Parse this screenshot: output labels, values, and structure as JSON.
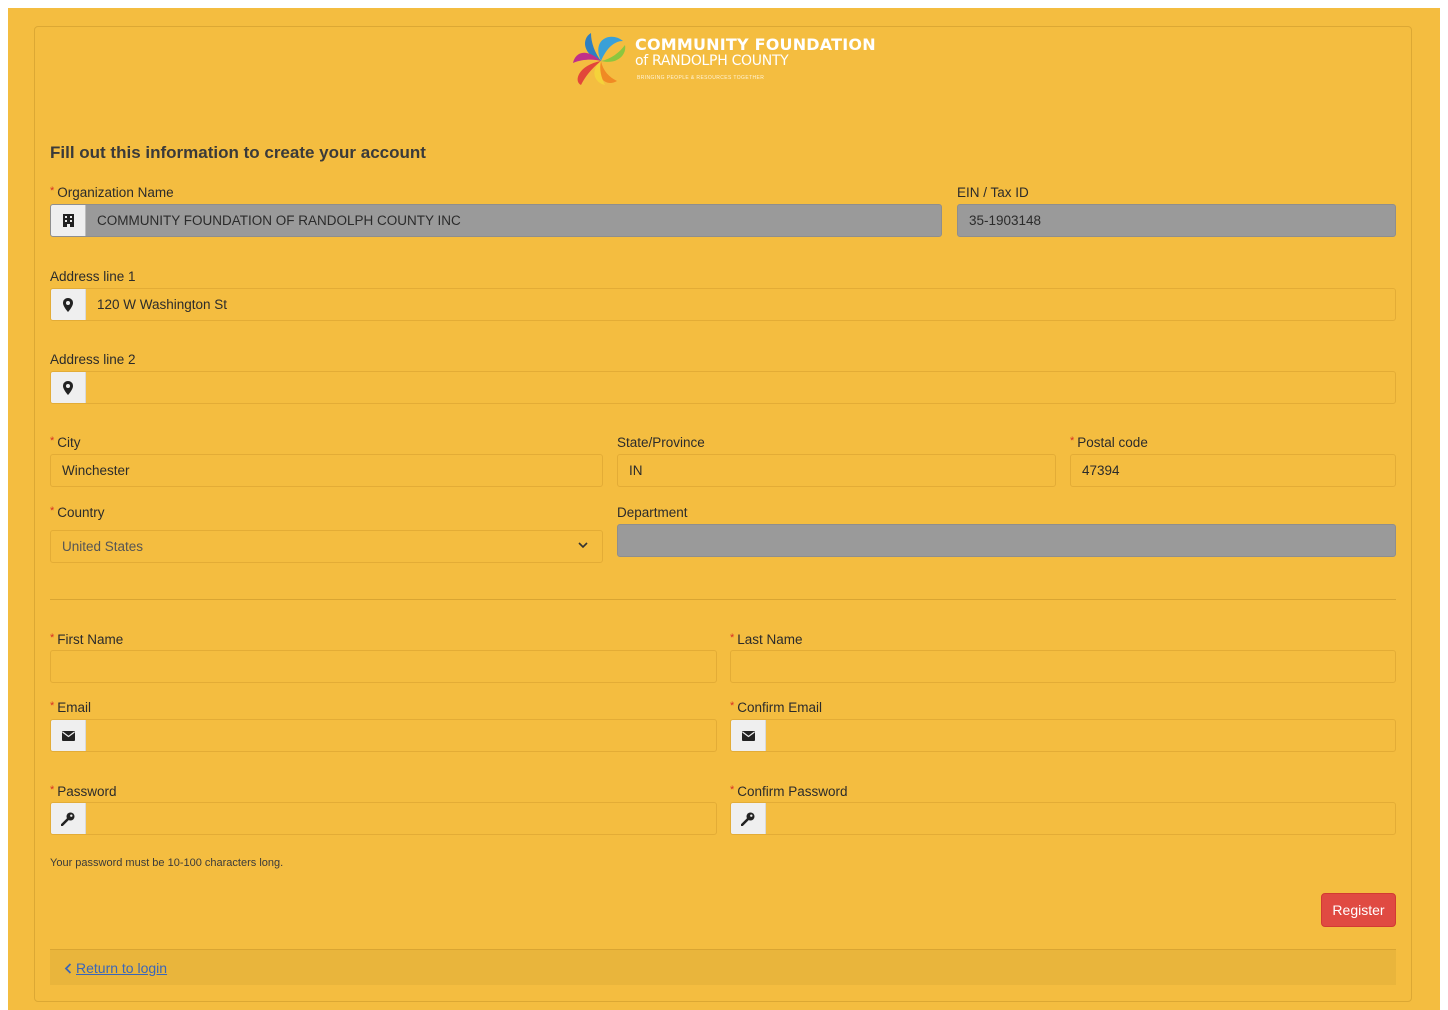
{
  "brand": {
    "line1": "COMMUNITY FOUNDATION",
    "line2": "of RANDOLPH COUNTY",
    "tagline": "Bringing people & resources together"
  },
  "form": {
    "heading": "Fill out this information to create your account",
    "org_name": {
      "label": "Organization Name",
      "value": "COMMUNITY FOUNDATION OF RANDOLPH COUNTY INC",
      "icon": "building-icon"
    },
    "ein": {
      "label": "EIN / Tax ID",
      "value": "35-1903148"
    },
    "address1": {
      "label": "Address line 1",
      "value": "120 W Washington St",
      "icon": "map-pin-icon"
    },
    "address2": {
      "label": "Address line 2",
      "value": "",
      "icon": "map-pin-icon"
    },
    "city": {
      "label": "City",
      "value": "Winchester"
    },
    "state": {
      "label": "State/Province",
      "value": "IN"
    },
    "postal": {
      "label": "Postal code",
      "value": "47394"
    },
    "country": {
      "label": "Country",
      "value": "United States"
    },
    "department": {
      "label": "Department",
      "value": ""
    },
    "first_name": {
      "label": "First Name",
      "value": ""
    },
    "last_name": {
      "label": "Last Name",
      "value": ""
    },
    "email": {
      "label": "Email",
      "value": "",
      "icon": "envelope-icon"
    },
    "confirm_email": {
      "label": "Confirm Email",
      "value": "",
      "icon": "envelope-icon"
    },
    "password": {
      "label": "Password",
      "value": "",
      "icon": "key-icon"
    },
    "confirm_password": {
      "label": "Confirm Password",
      "value": "",
      "icon": "key-icon"
    },
    "password_hint": "Your password must be 10-100 characters long.",
    "register_label": "Register",
    "return_label": "Return to login"
  },
  "colors": {
    "background": "#f4bd40",
    "disabled_field": "#9a9a9a",
    "required": "#d93025",
    "register_button": "#e04a42",
    "link": "#3a66b8"
  }
}
